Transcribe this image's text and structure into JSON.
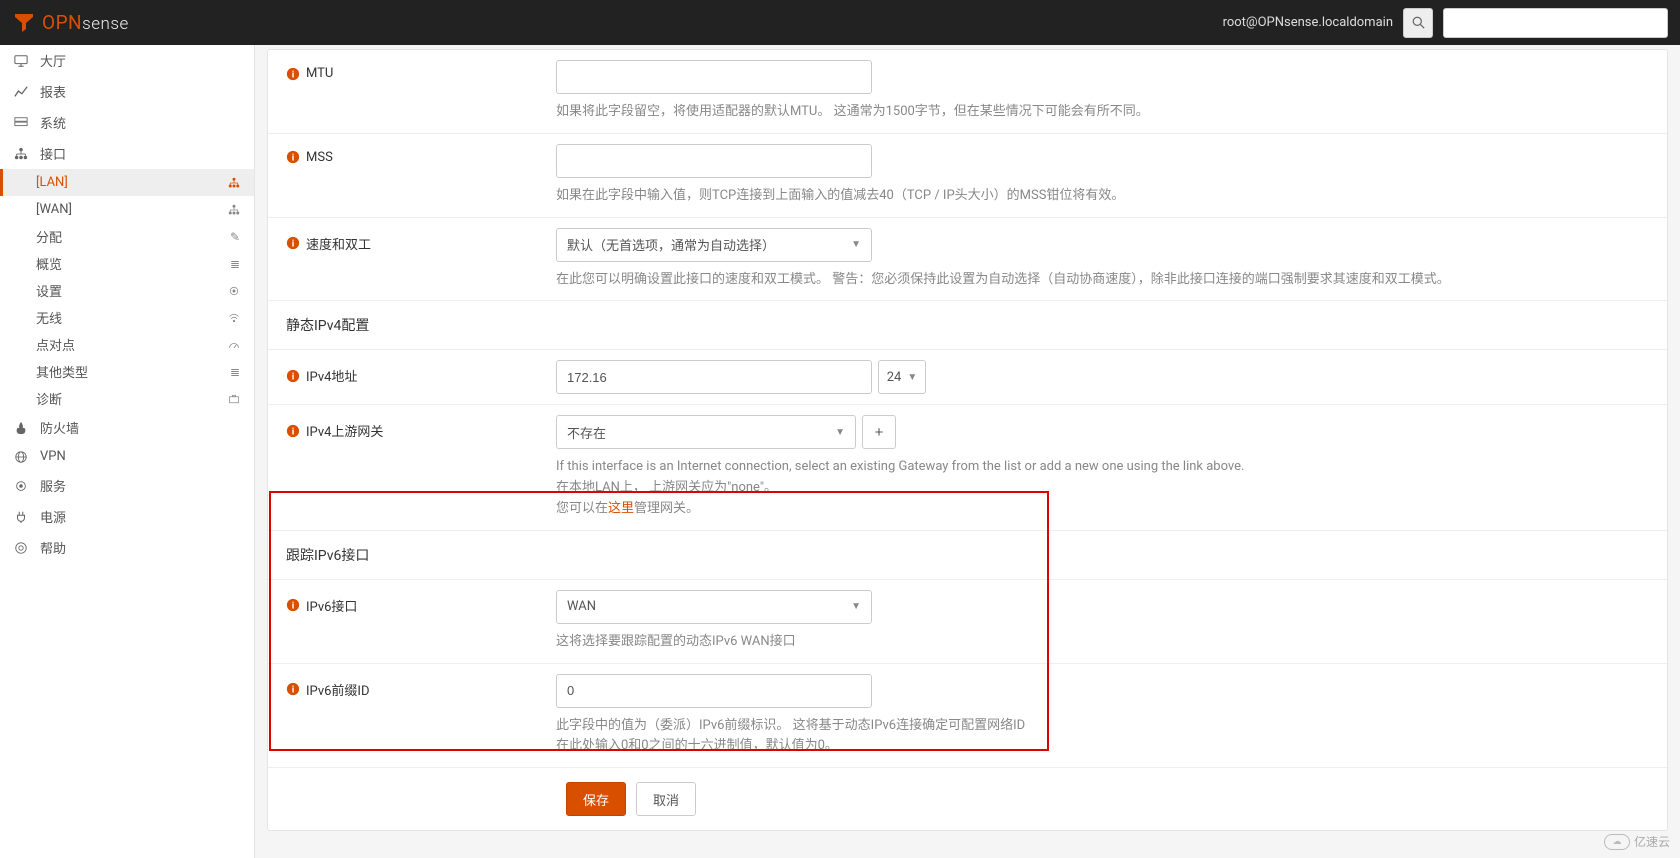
{
  "header": {
    "user": "root@OPNsense.localdomain",
    "search_placeholder": ""
  },
  "sidebar": {
    "items": [
      {
        "label": "大厅"
      },
      {
        "label": "报表"
      },
      {
        "label": "系统"
      },
      {
        "label": "接口",
        "expanded": true,
        "children": [
          {
            "label": "[LAN]",
            "icon": "sitemap",
            "active": true
          },
          {
            "label": "[WAN]",
            "icon": "sitemap"
          },
          {
            "label": "分配",
            "icon": "pencil"
          },
          {
            "label": "概览",
            "icon": "list"
          },
          {
            "label": "设置",
            "icon": "cogs"
          },
          {
            "label": "无线",
            "icon": "wifi"
          },
          {
            "label": "点对点",
            "icon": "dashboard"
          },
          {
            "label": "其他类型",
            "icon": "list"
          },
          {
            "label": "诊断",
            "icon": "briefcase"
          }
        ]
      },
      {
        "label": "防火墙"
      },
      {
        "label": "VPN"
      },
      {
        "label": "服务"
      },
      {
        "label": "电源"
      },
      {
        "label": "帮助"
      }
    ]
  },
  "form": {
    "mtu": {
      "label": "MTU",
      "value": "",
      "help": "如果将此字段留空，将使用适配器的默认MTU。 这通常为1500字节，但在某些情况下可能会有所不同。"
    },
    "mss": {
      "label": "MSS",
      "value": "",
      "help": "如果在此字段中输入值，则TCP连接到上面输入的值减去40（TCP / IP头大小）的MSS钳位将有效。"
    },
    "speed": {
      "label": "速度和双工",
      "select": "默认（无首选项，通常为自动选择）",
      "help": "在此您可以明确设置此接口的速度和双工模式。 警告：您必须保持此设置为自动选择（自动协商速度），除非此接口连接的端口强制要求其速度和双工模式。"
    },
    "ipv4_section": "静态IPv4配置",
    "ipv4_addr": {
      "label": "IPv4地址",
      "value": "172.16",
      "prefix": "24"
    },
    "ipv4_gw": {
      "label": "IPv4上游网关",
      "select": "不存在",
      "help1": "If this interface is an Internet connection, select an existing Gateway from the list or add a new one using the link above.",
      "help2": "在本地LAN上， 上游网关应为\"none\"。",
      "help3_pre": "您可以在",
      "help3_link": "这里",
      "help3_post": "管理网关。"
    },
    "ipv6_section": "跟踪IPv6接口",
    "ipv6_if": {
      "label": "IPv6接口",
      "select": "WAN",
      "help": "这将选择要跟踪配置的动态IPv6 WAN接口"
    },
    "ipv6_prefix": {
      "label": "IPv6前缀ID",
      "value": "0",
      "help1": "此字段中的值为（委派）IPv6前缀标识。 这将基于动态IPv6连接确定可配置网络ID",
      "help2": "在此处输入0和0之间的十六进制值，默认值为0。"
    },
    "save": "保存",
    "cancel": "取消"
  },
  "watermark": "亿速云"
}
